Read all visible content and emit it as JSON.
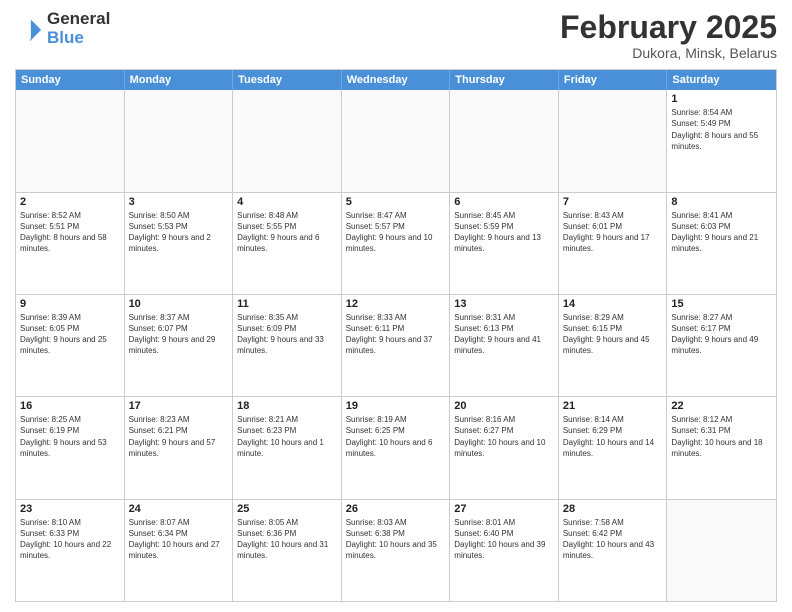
{
  "logo": {
    "general": "General",
    "blue": "Blue"
  },
  "title": "February 2025",
  "location": "Dukora, Minsk, Belarus",
  "days_of_week": [
    "Sunday",
    "Monday",
    "Tuesday",
    "Wednesday",
    "Thursday",
    "Friday",
    "Saturday"
  ],
  "weeks": [
    [
      {
        "day": "",
        "info": ""
      },
      {
        "day": "",
        "info": ""
      },
      {
        "day": "",
        "info": ""
      },
      {
        "day": "",
        "info": ""
      },
      {
        "day": "",
        "info": ""
      },
      {
        "day": "",
        "info": ""
      },
      {
        "day": "1",
        "info": "Sunrise: 8:54 AM\nSunset: 5:49 PM\nDaylight: 8 hours and 55 minutes."
      }
    ],
    [
      {
        "day": "2",
        "info": "Sunrise: 8:52 AM\nSunset: 5:51 PM\nDaylight: 8 hours and 58 minutes."
      },
      {
        "day": "3",
        "info": "Sunrise: 8:50 AM\nSunset: 5:53 PM\nDaylight: 9 hours and 2 minutes."
      },
      {
        "day": "4",
        "info": "Sunrise: 8:48 AM\nSunset: 5:55 PM\nDaylight: 9 hours and 6 minutes."
      },
      {
        "day": "5",
        "info": "Sunrise: 8:47 AM\nSunset: 5:57 PM\nDaylight: 9 hours and 10 minutes."
      },
      {
        "day": "6",
        "info": "Sunrise: 8:45 AM\nSunset: 5:59 PM\nDaylight: 9 hours and 13 minutes."
      },
      {
        "day": "7",
        "info": "Sunrise: 8:43 AM\nSunset: 6:01 PM\nDaylight: 9 hours and 17 minutes."
      },
      {
        "day": "8",
        "info": "Sunrise: 8:41 AM\nSunset: 6:03 PM\nDaylight: 9 hours and 21 minutes."
      }
    ],
    [
      {
        "day": "9",
        "info": "Sunrise: 8:39 AM\nSunset: 6:05 PM\nDaylight: 9 hours and 25 minutes."
      },
      {
        "day": "10",
        "info": "Sunrise: 8:37 AM\nSunset: 6:07 PM\nDaylight: 9 hours and 29 minutes."
      },
      {
        "day": "11",
        "info": "Sunrise: 8:35 AM\nSunset: 6:09 PM\nDaylight: 9 hours and 33 minutes."
      },
      {
        "day": "12",
        "info": "Sunrise: 8:33 AM\nSunset: 6:11 PM\nDaylight: 9 hours and 37 minutes."
      },
      {
        "day": "13",
        "info": "Sunrise: 8:31 AM\nSunset: 6:13 PM\nDaylight: 9 hours and 41 minutes."
      },
      {
        "day": "14",
        "info": "Sunrise: 8:29 AM\nSunset: 6:15 PM\nDaylight: 9 hours and 45 minutes."
      },
      {
        "day": "15",
        "info": "Sunrise: 8:27 AM\nSunset: 6:17 PM\nDaylight: 9 hours and 49 minutes."
      }
    ],
    [
      {
        "day": "16",
        "info": "Sunrise: 8:25 AM\nSunset: 6:19 PM\nDaylight: 9 hours and 53 minutes."
      },
      {
        "day": "17",
        "info": "Sunrise: 8:23 AM\nSunset: 6:21 PM\nDaylight: 9 hours and 57 minutes."
      },
      {
        "day": "18",
        "info": "Sunrise: 8:21 AM\nSunset: 6:23 PM\nDaylight: 10 hours and 1 minute."
      },
      {
        "day": "19",
        "info": "Sunrise: 8:19 AM\nSunset: 6:25 PM\nDaylight: 10 hours and 6 minutes."
      },
      {
        "day": "20",
        "info": "Sunrise: 8:16 AM\nSunset: 6:27 PM\nDaylight: 10 hours and 10 minutes."
      },
      {
        "day": "21",
        "info": "Sunrise: 8:14 AM\nSunset: 6:29 PM\nDaylight: 10 hours and 14 minutes."
      },
      {
        "day": "22",
        "info": "Sunrise: 8:12 AM\nSunset: 6:31 PM\nDaylight: 10 hours and 18 minutes."
      }
    ],
    [
      {
        "day": "23",
        "info": "Sunrise: 8:10 AM\nSunset: 6:33 PM\nDaylight: 10 hours and 22 minutes."
      },
      {
        "day": "24",
        "info": "Sunrise: 8:07 AM\nSunset: 6:34 PM\nDaylight: 10 hours and 27 minutes."
      },
      {
        "day": "25",
        "info": "Sunrise: 8:05 AM\nSunset: 6:36 PM\nDaylight: 10 hours and 31 minutes."
      },
      {
        "day": "26",
        "info": "Sunrise: 8:03 AM\nSunset: 6:38 PM\nDaylight: 10 hours and 35 minutes."
      },
      {
        "day": "27",
        "info": "Sunrise: 8:01 AM\nSunset: 6:40 PM\nDaylight: 10 hours and 39 minutes."
      },
      {
        "day": "28",
        "info": "Sunrise: 7:58 AM\nSunset: 6:42 PM\nDaylight: 10 hours and 43 minutes."
      },
      {
        "day": "",
        "info": ""
      }
    ]
  ]
}
